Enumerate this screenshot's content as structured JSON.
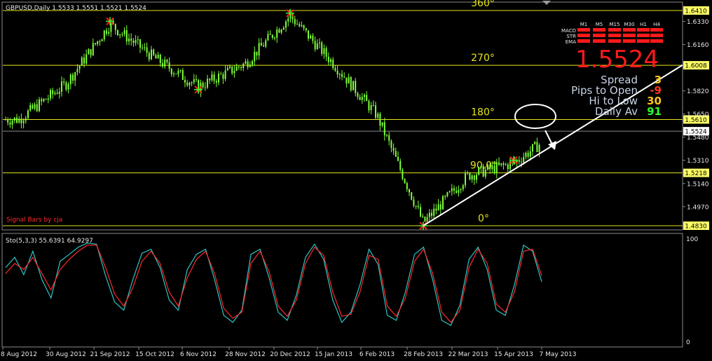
{
  "chart_data": [
    {
      "type": "candlestick",
      "symbol_header": "GBPUSD,Daily  1.5533 1.5551 1.5521 1.5524",
      "ylim": [
        1.483,
        1.641
      ],
      "level_lines": [
        {
          "label": "1.6410",
          "value": 1.641,
          "angle_label": "360°"
        },
        {
          "label": "1.6008",
          "value": 1.6008,
          "angle_label": "270°"
        },
        {
          "label": "1.5610",
          "value": 1.561,
          "angle_label": "180°"
        },
        {
          "label": "1.5218",
          "value": 1.5218,
          "angle_label": "90.0°"
        },
        {
          "label": "1.4830",
          "value": 1.483,
          "angle_label": "0°"
        }
      ],
      "current_price": {
        "label": "1.5524",
        "value": 1.5524
      },
      "price_ticks": [
        "1.6330",
        "1.6160",
        "1.5820",
        "1.5650",
        "1.5480",
        "1.5310",
        "1.5140",
        "1.4970"
      ],
      "price_tick_values": [
        1.633,
        1.616,
        1.582,
        1.565,
        1.548,
        1.531,
        1.514,
        1.497
      ],
      "x_labels": [
        "8 Aug 2012",
        "30 Aug 2012",
        "21 Sep 2012",
        "15 Oct 2012",
        "6 Nov 2012",
        "28 Nov 2012",
        "20 Dec 2012",
        "15 Jan 2013",
        "6 Feb 2013",
        "28 Feb 2013",
        "22 Mar 2013",
        "15 Apr 2013",
        "7 May 2013"
      ],
      "trendline": {
        "from": {
          "date": "28 Feb 2013",
          "price": 1.483
        },
        "to": {
          "date": "beyond 7 May 2013",
          "price": 1.601
        }
      },
      "price_path": [
        {
          "date": "8 Aug 2012",
          "price": 1.561
        },
        {
          "date": "30 Aug 2012",
          "price": 1.587
        },
        {
          "date": "21 Sep 2012",
          "price": 1.631
        },
        {
          "date": "15 Oct 2012",
          "price": 1.606
        },
        {
          "date": "6 Nov 2012",
          "price": 1.585
        },
        {
          "date": "28 Nov 2012",
          "price": 1.602
        },
        {
          "date": "20 Dec 2012",
          "price": 1.637
        },
        {
          "date": "15 Jan 2013",
          "price": 1.602
        },
        {
          "date": "6 Feb 2013",
          "price": 1.564
        },
        {
          "date": "28 Feb 2013",
          "price": 1.485
        },
        {
          "date": "22 Mar 2013",
          "price": 1.52
        },
        {
          "date": "15 Apr 2013",
          "price": 1.529
        },
        {
          "date": "7 May 2013",
          "price": 1.5524
        }
      ],
      "signal_markers": [
        {
          "date": "21 Sep 2012",
          "kind": "top"
        },
        {
          "date": "6 Nov 2012",
          "kind": "bottom"
        },
        {
          "date": "20 Dec 2012",
          "kind": "top"
        },
        {
          "date": "28 Feb 2013",
          "kind": "bottom"
        },
        {
          "date": "15 Apr 2013",
          "kind": "top"
        }
      ],
      "annotations": [
        "Signal Bars by cja"
      ]
    },
    {
      "type": "line",
      "title": "Sto(5,3,3) 55.6391 64.9297",
      "ylim": [
        0,
        100
      ],
      "y_ticks": [
        "100",
        "0"
      ],
      "series": [
        {
          "color": "#2ec4c4",
          "values": [
            72,
            82,
            65,
            88,
            60,
            42,
            78,
            85,
            92,
            96,
            95,
            64,
            38,
            30,
            60,
            86,
            90,
            72,
            40,
            30,
            70,
            85,
            90,
            60,
            25,
            18,
            30,
            85,
            90,
            62,
            28,
            20,
            45,
            82,
            95,
            80,
            40,
            18,
            28,
            55,
            90,
            75,
            25,
            20,
            48,
            85,
            92,
            60,
            20,
            15,
            35,
            80,
            92,
            70,
            30,
            25,
            55,
            94,
            88,
            58
          ]
        },
        {
          "color": "#ff2a2a",
          "values": [
            66,
            76,
            70,
            82,
            66,
            50,
            70,
            80,
            88,
            94,
            94,
            72,
            46,
            34,
            52,
            78,
            88,
            76,
            48,
            34,
            62,
            80,
            88,
            66,
            32,
            22,
            28,
            76,
            88,
            68,
            34,
            24,
            40,
            76,
            92,
            84,
            48,
            24,
            26,
            48,
            84,
            80,
            34,
            24,
            42,
            78,
            90,
            66,
            28,
            18,
            30,
            72,
            90,
            76,
            36,
            28,
            48,
            88,
            90,
            64
          ]
        }
      ]
    }
  ],
  "dashboard": {
    "timeframes": [
      "M1",
      "M5",
      "M15",
      "M30",
      "H1",
      "H4"
    ],
    "rows": [
      "MACD",
      "STR",
      "EMA"
    ],
    "big_price": "1.5524",
    "stats": [
      {
        "label": "Spread",
        "value": "3",
        "color": "#ffc61a"
      },
      {
        "label": "Pips to Open",
        "value": "-9",
        "color": "#ff3b1a"
      },
      {
        "label": "Hi to Low",
        "value": "30",
        "color": "#ffc61a"
      },
      {
        "label": "Daily Av",
        "value": "91",
        "color": "#2eff2e"
      }
    ]
  },
  "colors": {
    "background": "#000000",
    "candle": "#7fff3a",
    "level_line": "#e6e61a",
    "signal_red": "#ff2020",
    "dashboard_red": "#ff1a1a"
  }
}
